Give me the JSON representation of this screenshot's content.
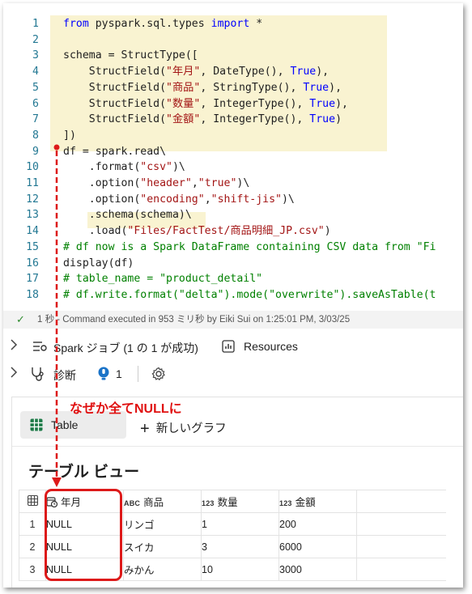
{
  "code": {
    "lines": [
      {
        "n": "1",
        "seg": [
          [
            "from ",
            "kw"
          ],
          [
            "pyspark.sql.types ",
            ""
          ],
          [
            "import ",
            "kw"
          ],
          [
            "*",
            ""
          ]
        ]
      },
      {
        "n": "2",
        "seg": []
      },
      {
        "n": "3",
        "seg": [
          [
            "schema = StructType([",
            ""
          ]
        ]
      },
      {
        "n": "4",
        "seg": [
          [
            "    StructField(",
            ""
          ],
          [
            "\"年月\"",
            "st"
          ],
          [
            ", DateType(), ",
            ""
          ],
          [
            "True",
            "kw"
          ],
          [
            "),",
            ""
          ]
        ]
      },
      {
        "n": "5",
        "seg": [
          [
            "    StructField(",
            ""
          ],
          [
            "\"商品\"",
            "st"
          ],
          [
            ", StringType(), ",
            ""
          ],
          [
            "True",
            "kw"
          ],
          [
            "),",
            ""
          ]
        ]
      },
      {
        "n": "6",
        "seg": [
          [
            "    StructField(",
            ""
          ],
          [
            "\"数量\"",
            "st"
          ],
          [
            ", IntegerType(), ",
            ""
          ],
          [
            "True",
            "kw"
          ],
          [
            "),",
            ""
          ]
        ]
      },
      {
        "n": "7",
        "seg": [
          [
            "    StructField(",
            ""
          ],
          [
            "\"金額\"",
            "st"
          ],
          [
            ", IntegerType(), ",
            ""
          ],
          [
            "True",
            "kw"
          ],
          [
            ")",
            ""
          ]
        ]
      },
      {
        "n": "8",
        "seg": [
          [
            "])",
            ""
          ]
        ]
      },
      {
        "n": "9",
        "seg": [
          [
            "df = spark.read\\",
            ""
          ]
        ]
      },
      {
        "n": "10",
        "seg": [
          [
            "    .format(",
            ""
          ],
          [
            "\"csv\"",
            "st"
          ],
          [
            ")\\",
            ""
          ]
        ]
      },
      {
        "n": "11",
        "seg": [
          [
            "    .option(",
            ""
          ],
          [
            "\"header\"",
            "st"
          ],
          [
            ",",
            ""
          ],
          [
            "\"true\"",
            "st"
          ],
          [
            ")\\",
            ""
          ]
        ]
      },
      {
        "n": "12",
        "seg": [
          [
            "    .option(",
            ""
          ],
          [
            "\"encoding\"",
            "st"
          ],
          [
            ",",
            ""
          ],
          [
            "\"shift-jis\"",
            "st"
          ],
          [
            ")\\",
            ""
          ]
        ]
      },
      {
        "n": "13",
        "seg": [
          [
            "    .schema(schema)\\",
            ""
          ]
        ]
      },
      {
        "n": "14",
        "seg": [
          [
            "    .load(",
            ""
          ],
          [
            "\"Files/FactTest/商品明細_JP.csv\"",
            "st"
          ],
          [
            ")",
            ""
          ]
        ]
      },
      {
        "n": "15",
        "seg": [
          [
            "# df now is a Spark DataFrame containing CSV data from \"Fi",
            "cm"
          ]
        ]
      },
      {
        "n": "16",
        "seg": [
          [
            "display(df)",
            ""
          ]
        ]
      },
      {
        "n": "17",
        "seg": [
          [
            "# table_name = \"product_detail\"",
            "cm"
          ]
        ]
      },
      {
        "n": "18",
        "seg": [
          [
            "# df.write.format(\"delta\").mode(\"overwrite\").saveAsTable(t",
            "cm"
          ]
        ]
      }
    ]
  },
  "status": {
    "check": "✓",
    "text": "1 秒 - Command executed in 953 ミリ秒 by Eiki Sui on 1:25:01 PM, 3/03/25"
  },
  "spark_jobs": {
    "label": "Spark ジョブ (1 の 1 が成功)",
    "resources": "Resources"
  },
  "diagnostics": {
    "label": "診断",
    "count": "1"
  },
  "tabs": {
    "table": "Table",
    "new_chart": "新しいグラフ"
  },
  "panel_title": "テーブル ビュー",
  "annotation": "なぜか全てNULLに",
  "table": {
    "columns": [
      {
        "type": "date",
        "label": "年月"
      },
      {
        "type": "ABC",
        "label": "商品"
      },
      {
        "type": "123",
        "label": "数量"
      },
      {
        "type": "123",
        "label": "金額"
      }
    ],
    "rows": [
      [
        "1",
        "NULL",
        "リンゴ",
        "1",
        "200"
      ],
      [
        "2",
        "NULL",
        "スイカ",
        "3",
        "6000"
      ],
      [
        "3",
        "NULL",
        "みかん",
        "10",
        "3000"
      ]
    ]
  },
  "colors": {
    "keyword": "#0000ff",
    "string": "#a31515",
    "comment": "#008000",
    "annotation": "#e01010",
    "highlight": "#f9f3d1"
  }
}
